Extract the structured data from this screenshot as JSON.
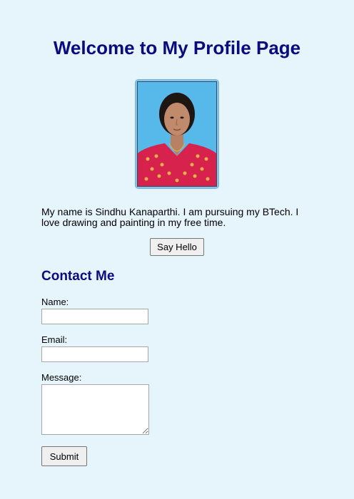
{
  "header": {
    "title": "Welcome to My Profile Page"
  },
  "profile": {
    "photo_icon": "profile-photo",
    "bio": "My name is Sindhu Kanaparthi. I am pursuing my BTech. I love drawing and painting in my free time.",
    "hello_button_label": "Say Hello"
  },
  "contact": {
    "heading": "Contact Me",
    "name_label": "Name:",
    "name_value": "",
    "email_label": "Email:",
    "email_value": "",
    "message_label": "Message:",
    "message_value": "",
    "submit_label": "Submit"
  },
  "colors": {
    "background": "#e6f4fc",
    "heading": "#0b0b80",
    "photo_backdrop": "#57b8ea",
    "dress": "#d8224e"
  }
}
